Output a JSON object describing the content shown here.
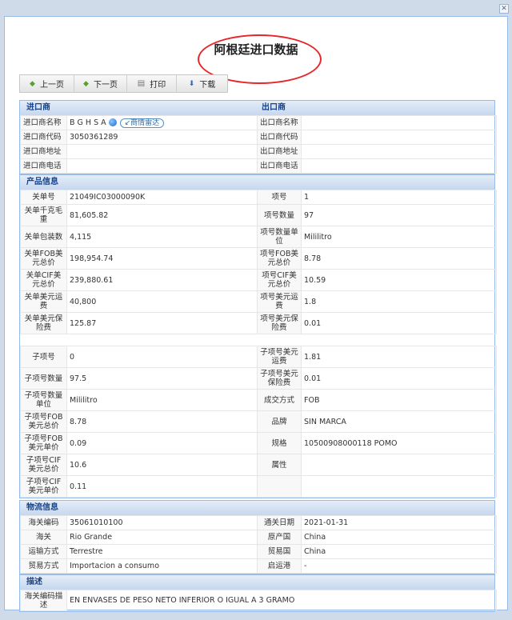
{
  "window": {
    "close_icon": "close-icon"
  },
  "title": "阿根廷进口数据",
  "colors": {
    "annotation": "#e8262a",
    "section_header": "#15428b"
  },
  "toolbar": [
    {
      "label": "上一页",
      "icon": "arrow-left-icon"
    },
    {
      "label": "下一页",
      "icon": "arrow-right-icon"
    },
    {
      "label": "打印",
      "icon": "printer-icon"
    },
    {
      "label": "下载",
      "icon": "arrow-down-icon"
    }
  ],
  "importer": {
    "title": "进口商",
    "exporter_title": "出口商",
    "radar_label": "商情雷达",
    "rows": [
      [
        "进口商名称",
        "B G H S A",
        "出口商名称",
        ""
      ],
      [
        "进口商代码",
        "3050361289",
        "出口商代码",
        ""
      ],
      [
        "进口商地址",
        "",
        "出口商地址",
        ""
      ],
      [
        "进口商电话",
        "",
        "出口商电话",
        ""
      ]
    ]
  },
  "product": {
    "title": "产品信息",
    "rows": [
      [
        "关单号",
        "21049IC03000090K",
        "项号",
        "1"
      ],
      [
        "关单千克毛重",
        "81,605.82",
        "项号数量",
        "97"
      ],
      [
        "关单包装数",
        "4,115",
        "项号数量单位",
        "Mililitro"
      ],
      [
        "关单FOB美元总价",
        "198,954.74",
        "项号FOB美元总价",
        "8.78"
      ],
      [
        "关单CIF美元总价",
        "239,880.61",
        "项号CIF美元总价",
        "10.59"
      ],
      [
        "关单美元运费",
        "40,800",
        "项号美元运费",
        "1.8"
      ],
      [
        "关单美元保险费",
        "125.87",
        "项号美元保险费",
        "0.01"
      ]
    ],
    "sub_rows": [
      [
        "子项号",
        "0",
        "子项号美元运费",
        "1.81"
      ],
      [
        "子项号数量",
        "97.5",
        "子项号美元保险费",
        "0.01"
      ],
      [
        "子项号数量单位",
        "Mililitro",
        "成交方式",
        "FOB"
      ],
      [
        "子项号FOB美元总价",
        "8.78",
        "品牌",
        "SIN MARCA"
      ],
      [
        "子项号FOB美元单价",
        "0.09",
        "规格",
        "10500908000118 POMO"
      ],
      [
        "子项号CIF美元总价",
        "10.6",
        "属性",
        ""
      ],
      [
        "子项号CIF美元单价",
        "0.11",
        "",
        ""
      ]
    ]
  },
  "logistics": {
    "title": "物流信息",
    "rows": [
      [
        "海关编码",
        "35061010100",
        "通关日期",
        "2021-01-31"
      ],
      [
        "海关",
        "Rio Grande",
        "原产国",
        "China"
      ],
      [
        "运输方式",
        "Terrestre",
        "贸易国",
        "China"
      ],
      [
        "贸易方式",
        "Importacion a consumo",
        "启运港",
        "-"
      ]
    ]
  },
  "description": {
    "title": "描述",
    "rows": [
      [
        "海关编码描述",
        "EN ENVASES DE PESO NETO INFERIOR O IGUAL A 3 GRAMO"
      ]
    ]
  }
}
